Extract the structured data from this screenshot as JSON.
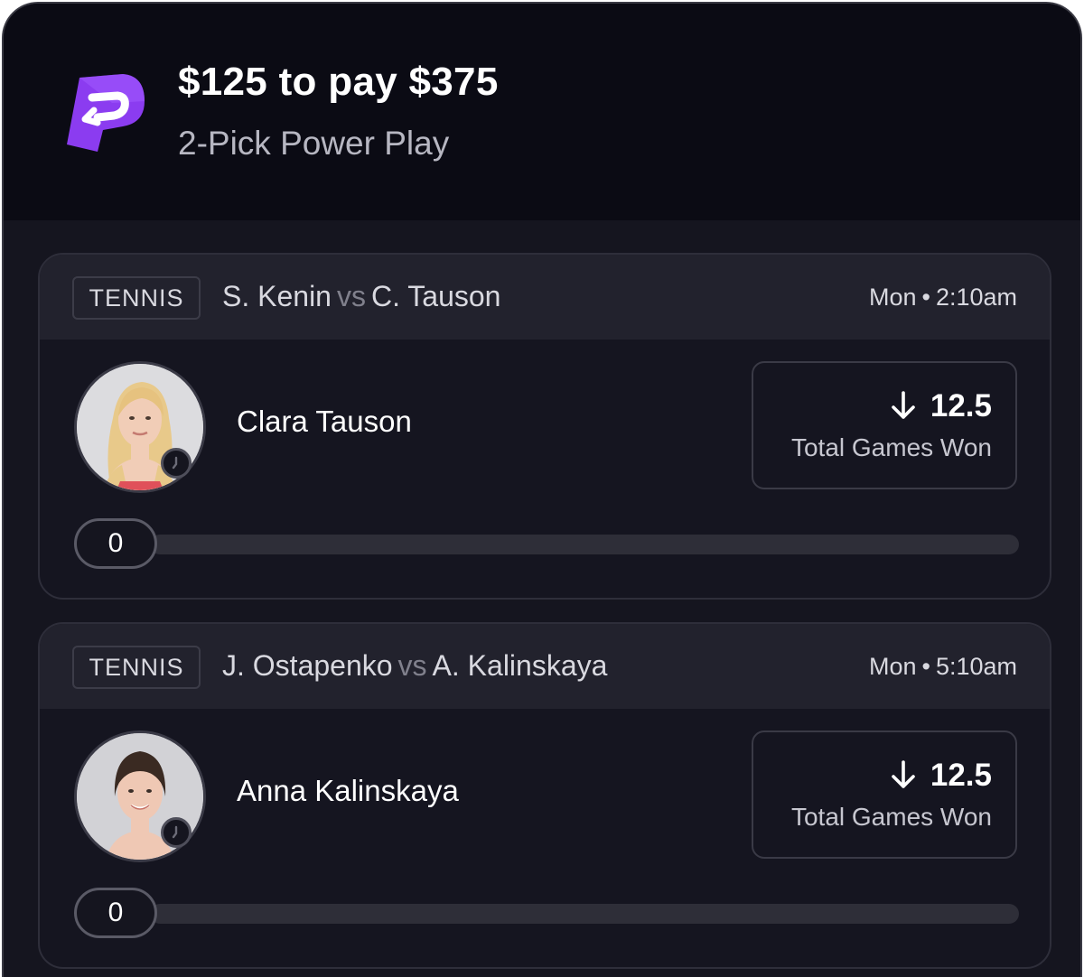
{
  "entry": {
    "title": "$125 to pay $375",
    "subtitle": "2-Pick Power Play",
    "brand_color": "#7c3aed"
  },
  "picks": [
    {
      "sport": "TENNIS",
      "player_a": "S. Kenin",
      "vs": "vs",
      "player_b": "C. Tauson",
      "day": "Mon",
      "separator": "•",
      "time": "2:10am",
      "player_name": "Clara Tauson",
      "direction_icon": "arrow-down-icon",
      "line": "12.5",
      "stat": "Total Games Won",
      "progress_value": "0",
      "progress_fraction": 0,
      "avatar_icon": "player-photo"
    },
    {
      "sport": "TENNIS",
      "player_a": "J. Ostapenko",
      "vs": "vs",
      "player_b": "A. Kalinskaya",
      "day": "Mon",
      "separator": "•",
      "time": "5:10am",
      "player_name": "Anna Kalinskaya",
      "direction_icon": "arrow-down-icon",
      "line": "12.5",
      "stat": "Total Games Won",
      "progress_value": "0",
      "progress_fraction": 0,
      "avatar_icon": "player-photo"
    }
  ]
}
